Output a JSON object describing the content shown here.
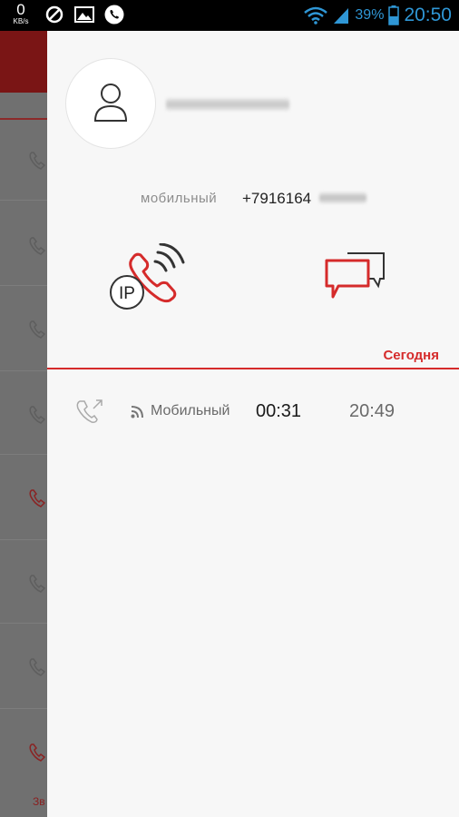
{
  "statusbar": {
    "net_speed": "0",
    "net_unit": "KB/s",
    "battery_pct": "39%",
    "time": "20:50",
    "icons": [
      "blocked-icon",
      "image-icon",
      "viber-icon",
      "wifi-icon",
      "signal-icon",
      "battery-icon"
    ]
  },
  "background_app": {
    "bottom_label": "Зв"
  },
  "contact": {
    "phone_type": "мобильный",
    "phone_number": "+7916164"
  },
  "actions": {
    "ip_badge": "IP",
    "ip_call_icon": "ip-call-icon",
    "message_icon": "message-icon"
  },
  "history": {
    "section_label": "Сегодня",
    "calls": [
      {
        "icon": "outgoing-call-icon",
        "type": "Мобильный",
        "duration": "00:31",
        "time": "20:49"
      }
    ]
  },
  "colors": {
    "accent": "#d52b2b",
    "status_blue": "#2f97d6",
    "panel_bg": "#f7f7f7"
  }
}
